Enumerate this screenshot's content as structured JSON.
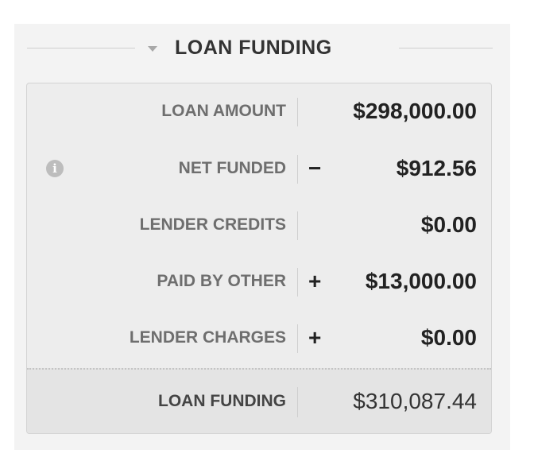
{
  "section": {
    "title": "LOAN FUNDING",
    "caret_icon": "caret-down-icon"
  },
  "rows": [
    {
      "label": "LOAN AMOUNT",
      "sign": "",
      "value": "$298,000.00"
    },
    {
      "label": "NET FUNDED",
      "sign": "−",
      "value": "$912.56",
      "info_icon": "info-icon",
      "info_glyph": "i"
    },
    {
      "label": "LENDER CREDITS",
      "sign": "",
      "value": "$0.00"
    },
    {
      "label": "PAID BY OTHER",
      "sign": "+",
      "value": "$13,000.00"
    },
    {
      "label": "LENDER CHARGES",
      "sign": "+",
      "value": "$0.00"
    }
  ],
  "total": {
    "label": "LOAN FUNDING",
    "value": "$310,087.44"
  },
  "colors": {
    "panel_background": "#f3f3f3",
    "card_background": "#ededed",
    "total_background": "#e4e4e4",
    "label_text": "#6e6e6e",
    "value_text": "#222222"
  }
}
